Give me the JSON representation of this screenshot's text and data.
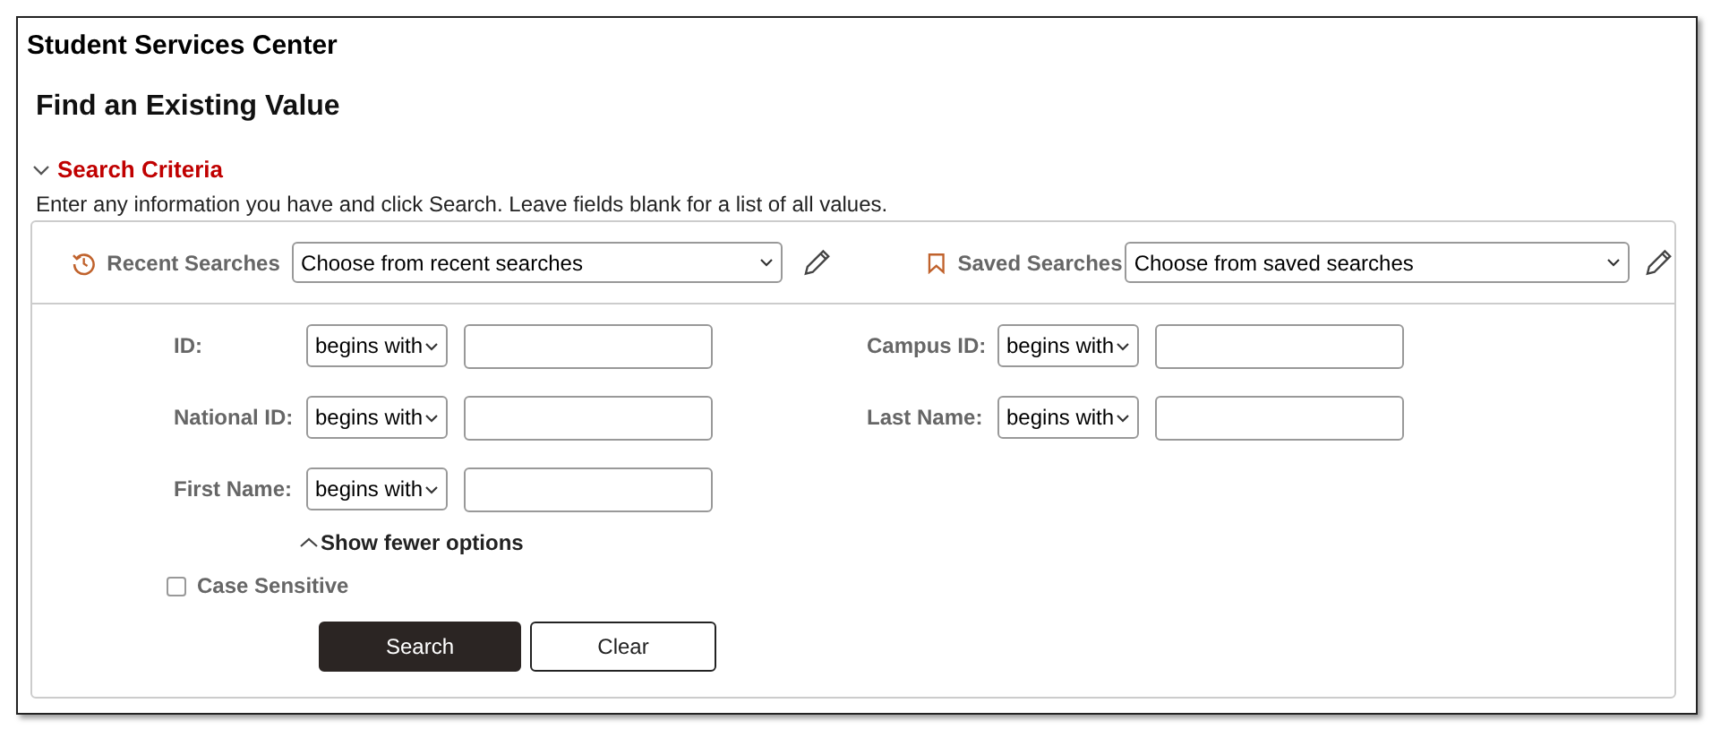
{
  "app_title": "Student Services Center",
  "page_heading": "Find an Existing Value",
  "section": {
    "label": "Search Criteria",
    "expanded": true
  },
  "instructions": "Enter any information you have and click Search. Leave fields blank for a list of all values.",
  "recent_searches": {
    "label": "Recent Searches",
    "value": "Choose from recent searches"
  },
  "saved_searches": {
    "label": "Saved Searches",
    "value": "Choose from saved searches"
  },
  "left_fields": [
    {
      "label": "ID:",
      "operator": "begins with"
    },
    {
      "label": "National ID:",
      "operator": "begins with"
    },
    {
      "label": "First Name:",
      "operator": "begins with"
    }
  ],
  "right_fields": [
    {
      "label": "Campus ID:",
      "operator": "begins with"
    },
    {
      "label": "Last Name:",
      "operator": "begins with"
    }
  ],
  "options_toggle": {
    "label": "Show fewer options",
    "expanded": true
  },
  "case_sensitive": {
    "label": "Case Sensitive",
    "checked": false
  },
  "buttons": [
    {
      "label": "Search",
      "kind": "primary"
    },
    {
      "label": "Clear",
      "kind": "secondary"
    }
  ]
}
